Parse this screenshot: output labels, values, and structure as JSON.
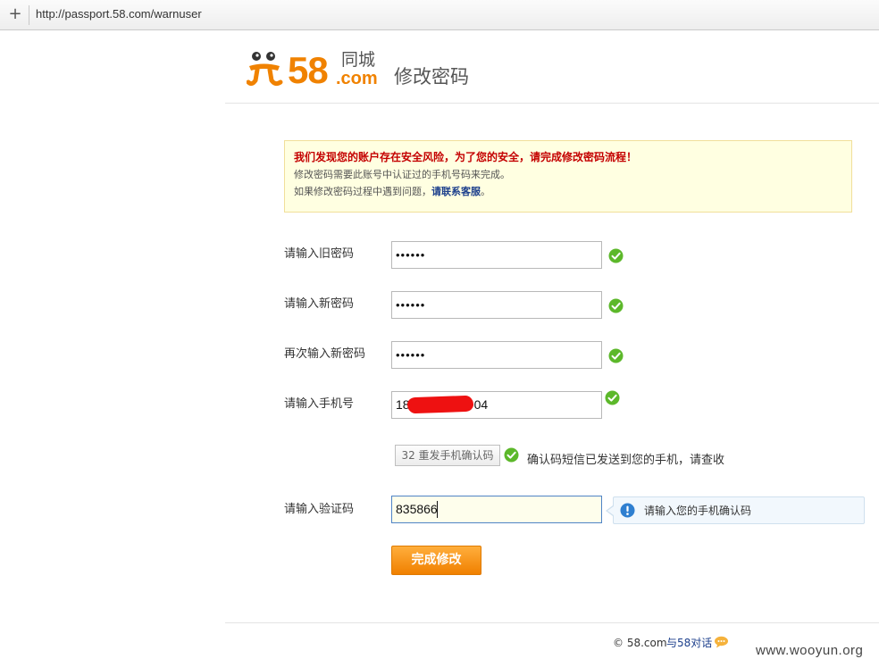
{
  "browser": {
    "url": "http://passport.58.com/warnuser",
    "new_tab_icon": "plus-icon"
  },
  "header": {
    "logo_number": "58",
    "logo_tongcheng": "同城",
    "logo_dotcom": ".com",
    "page_title": "修改密码"
  },
  "notice": {
    "warning": "我们发现您的账户存在安全风险，为了您的安全，请完成修改密码流程！",
    "line1": "修改密码需要此账号中认证过的手机号码来完成。",
    "line2_prefix": "如果修改密码过程中遇到问题，",
    "line2_link": "请联系客服",
    "line2_suffix": "。"
  },
  "form": {
    "old_password_label": "请输入旧密码",
    "old_password_value": "••••••",
    "new_password_label": "请输入新密码",
    "new_password_value": "••••••",
    "confirm_password_label": "再次输入新密码",
    "confirm_password_value": "••••••",
    "phone_label": "请输入手机号",
    "phone_prefix": "18",
    "phone_suffix": "04",
    "resend_button": "32 重发手机确认码",
    "sms_sent_message": "确认码短信已发送到您的手机，请查收",
    "code_label": "请输入验证码",
    "code_value": "835866",
    "code_tip": "请输入您的手机确认码",
    "submit_button": "完成修改"
  },
  "footer": {
    "copyright": "© 58.com",
    "chat_link": "与58对话"
  },
  "watermark": "www.wooyun.org",
  "colors": {
    "brand_orange": "#f08200",
    "warning_red": "#c40000",
    "success_green": "#5cb82a",
    "info_blue": "#2f7fd0"
  }
}
